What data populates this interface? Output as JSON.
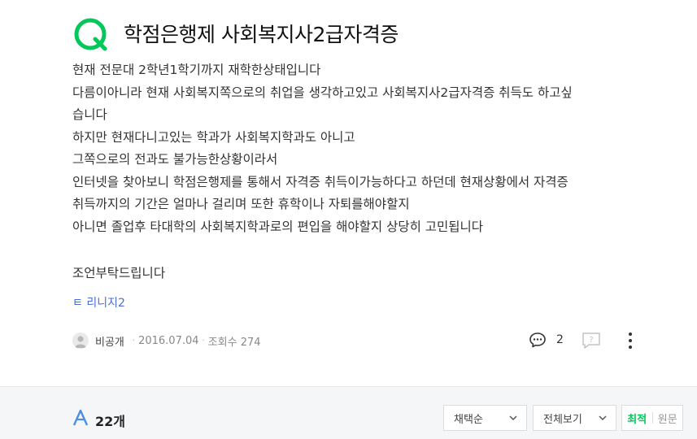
{
  "question": {
    "title": "학점은행제 사회복지사2급자격증",
    "body": [
      "현재 전문대 2학년1학기까지 재학한상태입니다",
      "다름이아니라 현재 사회복지쪽으로의 취업을 생각하고있고 사회복지사2급자격증 취득도 하고싶",
      "습니다",
      "하지만 현재다니고있는 학과가 사회복지학과도 아니고",
      "그쪽으로의 전과도 불가능한상황이라서",
      "인터넷을 찾아보니 학점은행제를 통해서 자격증 취득이가능하다고 하던데 현재상황에서 자격증",
      "취득까지의 기간은 얼마나 걸리며 또한 휴학이나 자퇴를해야할지",
      "아니면 졸업후 타대학의 사회복지학과로의 편입을 해야할지 상당히 고민됩니다"
    ],
    "closing": "조언부탁드립니다",
    "tag_link": "ㅌ 리니지2",
    "author": "비공개",
    "date": "2016.07.04",
    "views_label": "조회수 274",
    "comment_count": "2"
  },
  "answers": {
    "count_label": "22개",
    "sort_select": "채택순",
    "filter_select": "전체보기",
    "toggle_active": "최적",
    "toggle_inactive": "원문"
  },
  "colors": {
    "brand_green": "#03c75a",
    "answer_blue": "#4a90e2",
    "link_blue": "#4a6fd6"
  },
  "icons": [
    "q-logo-icon",
    "avatar-icon",
    "comment-icon",
    "report-icon",
    "more-icon",
    "a-logo-icon",
    "chevron-down-icon"
  ]
}
